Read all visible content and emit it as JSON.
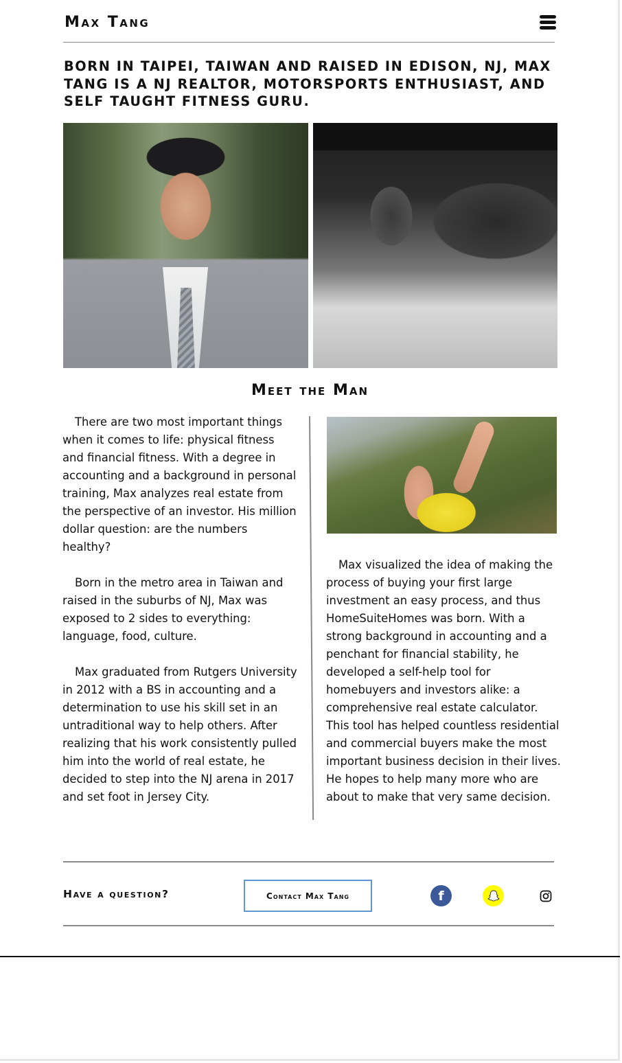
{
  "header": {
    "site_title": "Max Tang",
    "menu_icon": "hamburger-menu-icon"
  },
  "intro": {
    "text": "Born in Taipei, Taiwan and raised in Edison, NJ, Max Tang is a NJ realtor, motorsports enthusiast, and self taught fitness guru."
  },
  "section": {
    "title": "Meet the Man"
  },
  "left_column": {
    "paragraphs": [
      "There are two most important things when it comes to life: physical fitness and financial fitness. With a degree in accounting and a background in personal training, Max analyzes real estate from the perspective of an investor. His million dollar question: are the numbers healthy?",
      "Born in the metro area in Taiwan and raised in the suburbs of NJ, Max was exposed to 2 sides to everything: language, food, culture.",
      "Max graduated from Rutgers University in 2012 with a BS in accounting and a determination to use his skill set in an untraditional way to help others. After realizing that his work consistently pulled him into the world of real estate, he decided to step into the NJ arena in 2017 and set foot in Jersey City."
    ]
  },
  "right_column": {
    "paragraph": "Max visualized the idea of making the process of buying your first large investment an easy process, and thus HomeSuiteHomes was born. With a strong background in accounting and a penchant for financial stability, he developed a self-help tool for homebuyers and investors alike: a comprehensive real estate calculator. This tool has helped countless residential and commercial buyers make the most important business decision in their lives. He hopes to help many more who are about to make that very same decision."
  },
  "footer": {
    "question": "Have a question?",
    "contact_label": "Contact Max Tang",
    "social": {
      "facebook_glyph": "f",
      "icons": [
        "facebook-icon",
        "snapchat-icon",
        "instagram-icon"
      ]
    }
  },
  "colors": {
    "button_border": "#5f96d6",
    "facebook": "#3b5998",
    "snapchat": "#fffc00"
  }
}
